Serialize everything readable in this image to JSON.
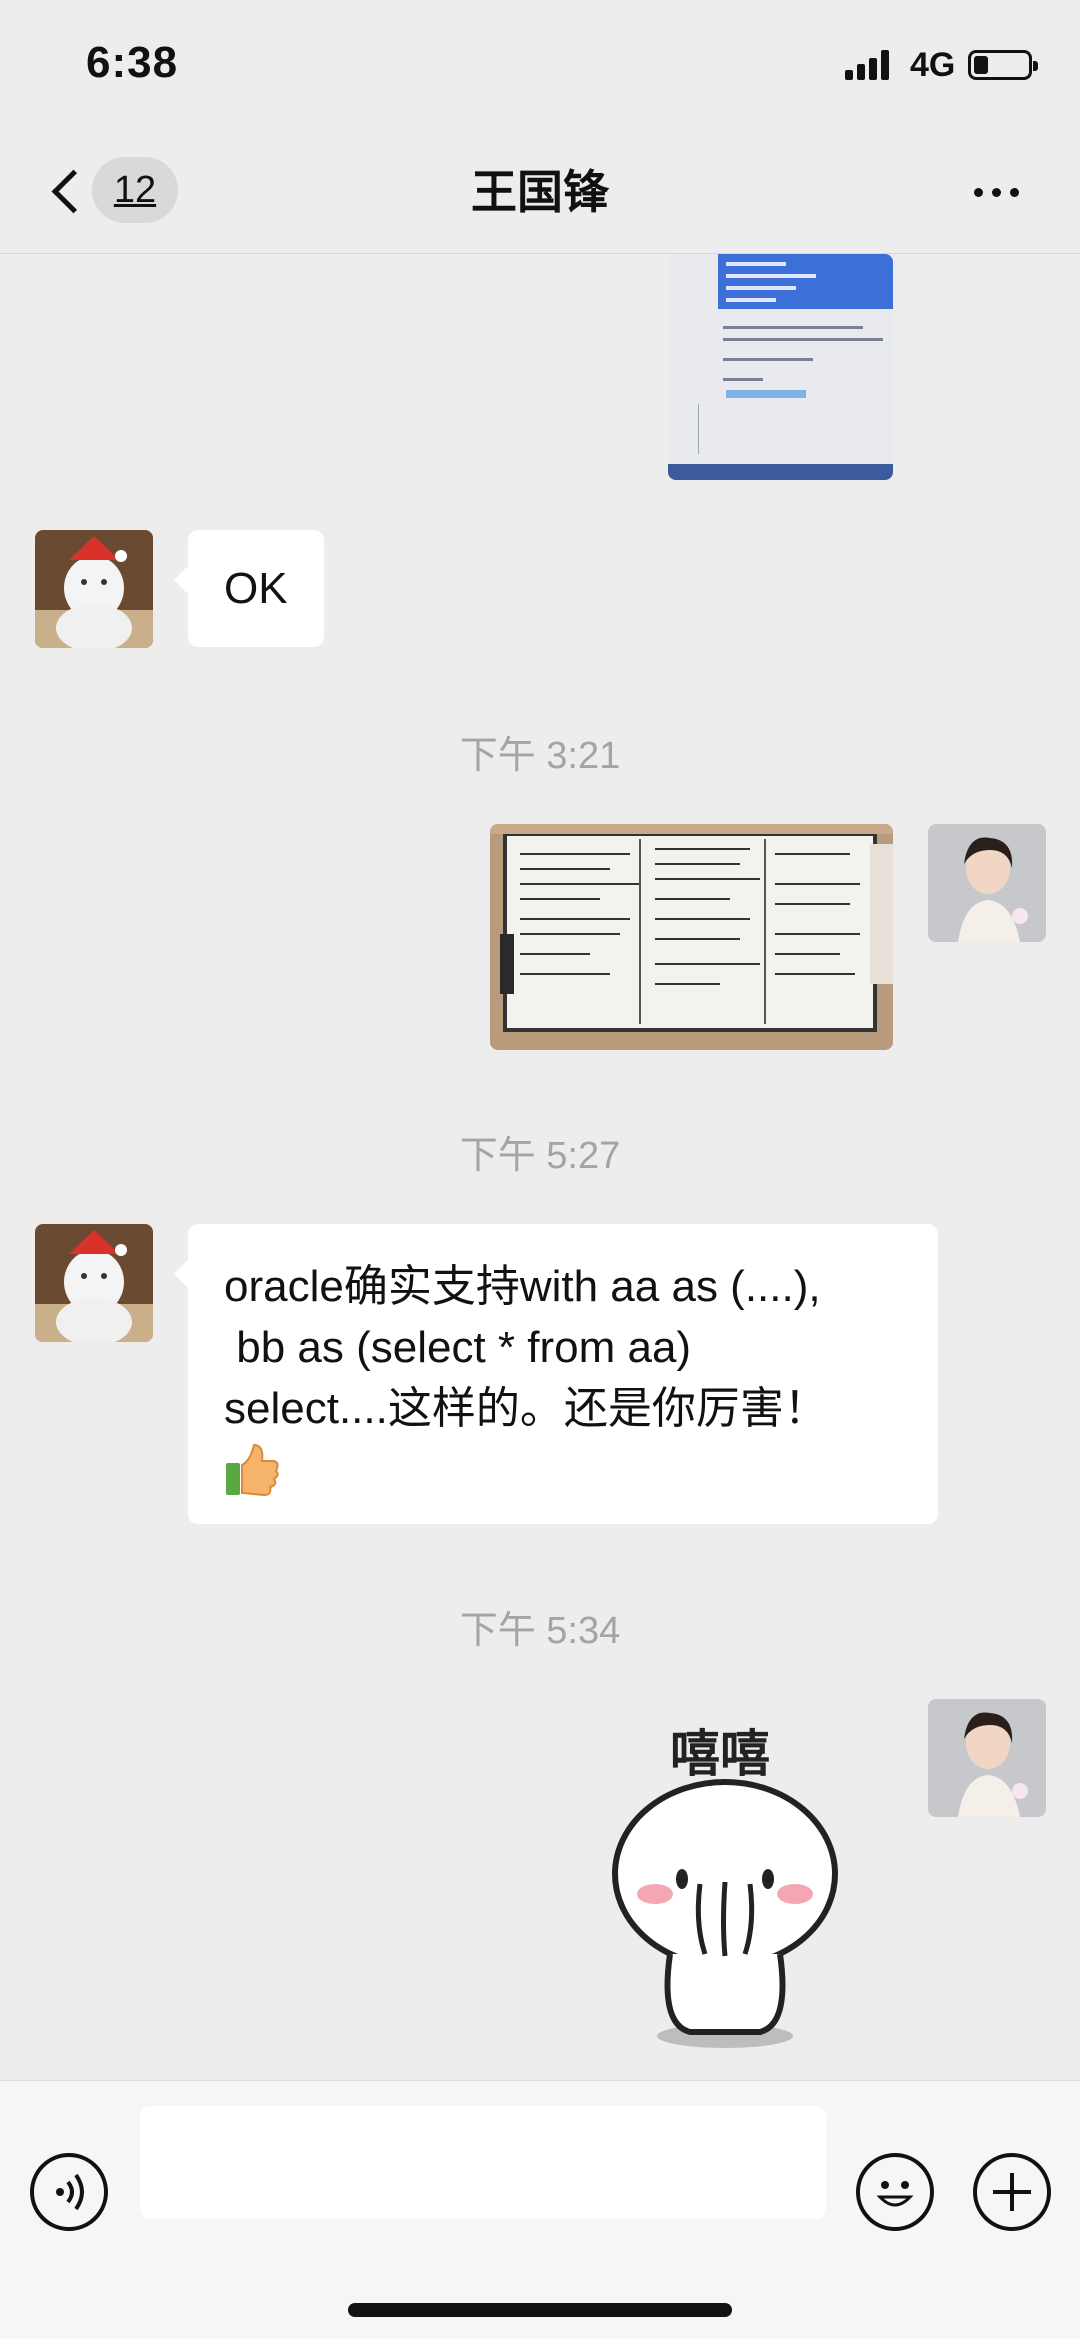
{
  "status_bar": {
    "time": "6:38",
    "network": "4G",
    "icons": [
      "signal-icon",
      "battery-icon"
    ]
  },
  "nav": {
    "unread_count": "12",
    "title": "王国锋",
    "icons": [
      "back-chevron-icon",
      "more-icon"
    ]
  },
  "messages": [
    {
      "type": "image",
      "side": "right",
      "content": "screenshot of SQL code editor"
    },
    {
      "type": "text",
      "side": "left",
      "text": "OK"
    },
    {
      "type": "timestamp",
      "text": "下午 3:21"
    },
    {
      "type": "image",
      "side": "right",
      "content": "photo of whiteboard with handwritten notes"
    },
    {
      "type": "timestamp",
      "text": "下午 5:27"
    },
    {
      "type": "text",
      "side": "left",
      "lines": [
        "oracle确实支持with aa as (....),",
        " bb as (select * from aa)",
        "select....这样的。还是你厉害！"
      ],
      "emoji": "thumbs-up-icon"
    },
    {
      "type": "timestamp",
      "text": "下午 5:34"
    },
    {
      "type": "sticker",
      "side": "right",
      "caption": "嘻嘻"
    }
  ],
  "input_bar": {
    "placeholder": "",
    "icons": [
      "voice-icon",
      "emoji-icon",
      "plus-icon"
    ]
  },
  "colors": {
    "background": "#ededed",
    "bubble_left": "#ffffff",
    "timestamp": "#a4a4a4",
    "input_bar": "#f6f6f6"
  }
}
